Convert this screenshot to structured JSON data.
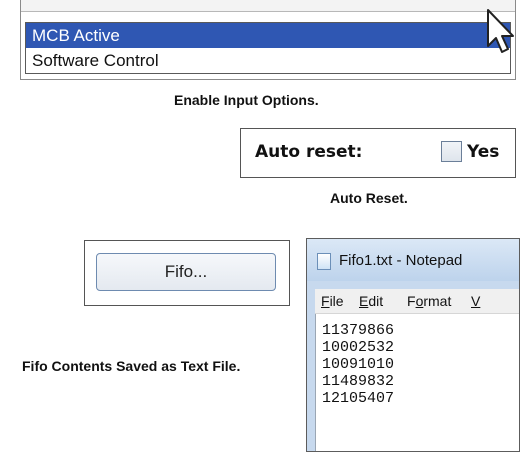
{
  "enable_input": {
    "options": [
      "MCB Active",
      "Software Control"
    ],
    "selected_index": 0,
    "caption": "Enable Input Options."
  },
  "auto_reset": {
    "label": "Auto reset:",
    "checkbox_label": "Yes",
    "checked": false,
    "caption": "Auto Reset."
  },
  "fifo": {
    "button_label": "Fifo...",
    "caption": "Fifo Contents Saved as Text File."
  },
  "notepad": {
    "title": "Fifo1.txt - Notepad",
    "menu": [
      {
        "prefix": "",
        "accel": "F",
        "rest": "ile"
      },
      {
        "prefix": "",
        "accel": "E",
        "rest": "dit"
      },
      {
        "prefix": "F",
        "accel": "o",
        "rest": "rmat"
      },
      {
        "prefix": "",
        "accel": "V",
        "rest": ""
      }
    ],
    "lines": [
      "11379866",
      "10002532",
      "10091010",
      "11489832",
      "12105407"
    ]
  },
  "colors": {
    "selection": "#2f57b3",
    "window_titlebar": "#c7d9ee"
  },
  "icons": {
    "cursor": "mouse-pointer-icon",
    "notepad": "notepad-file-icon"
  }
}
